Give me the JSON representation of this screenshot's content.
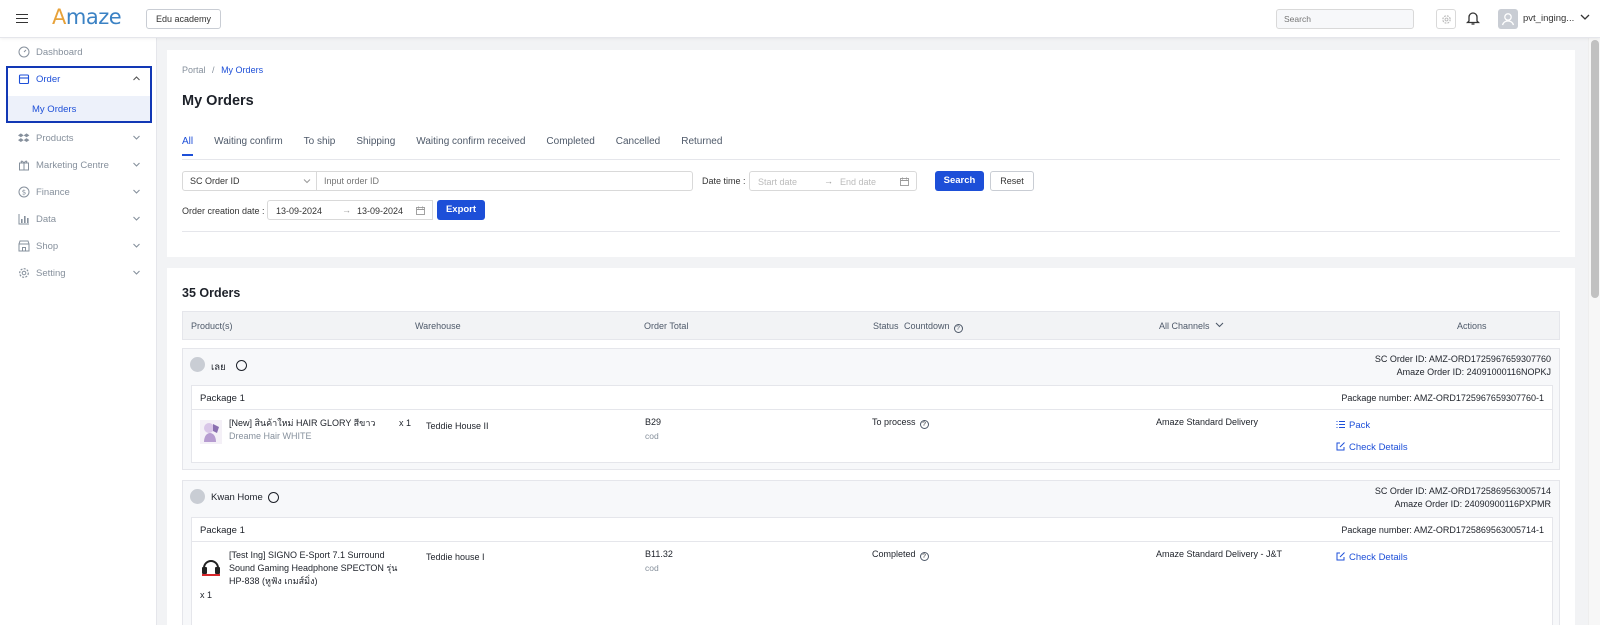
{
  "header": {
    "logo_prefix": "A",
    "logo_rest": "maze",
    "org_button": "Edu academy",
    "search_placeholder": "Search",
    "user_name": "pvt_inging..."
  },
  "sidebar": {
    "items": [
      {
        "label": "Dashboard",
        "icon": "dashboard-icon"
      },
      {
        "label": "Order",
        "icon": "order-icon"
      },
      {
        "label": "Products",
        "icon": "products-icon"
      },
      {
        "label": "Marketing Centre",
        "icon": "marketing-icon"
      },
      {
        "label": "Finance",
        "icon": "finance-icon"
      },
      {
        "label": "Data",
        "icon": "data-icon"
      },
      {
        "label": "Shop",
        "icon": "shop-icon"
      },
      {
        "label": "Setting",
        "icon": "setting-icon"
      }
    ],
    "sub_item": "My Orders"
  },
  "breadcrumb": {
    "root": "Portal",
    "sep": "/",
    "current": "My Orders"
  },
  "page_title": "My Orders",
  "tabs": [
    "All",
    "Waiting confirm",
    "To ship",
    "Shipping",
    "Waiting confirm received",
    "Completed",
    "Cancelled",
    "Returned"
  ],
  "filters": {
    "id_type": "SC Order ID",
    "order_id_placeholder": "Input order ID",
    "date_time_label": "Date time :",
    "start_placeholder": "Start date",
    "end_placeholder": "End date",
    "arrow": "→",
    "search_btn": "Search",
    "reset_btn": "Reset",
    "creation_label": "Order creation date :",
    "creation_start": "13-09-2024",
    "creation_end": "13-09-2024",
    "export_btn": "Export"
  },
  "orders_count": "35 Orders",
  "table_headers": {
    "product": "Product(s)",
    "warehouse": "Warehouse",
    "order_total": "Order Total",
    "status": "Status",
    "countdown": "Countdown",
    "channels": "All Channels",
    "actions": "Actions"
  },
  "orders": [
    {
      "shop": "เลย",
      "sc_order_id": "SC Order ID: AMZ-ORD1725967659307760",
      "amaze_order_id": "Amaze Order ID: 24091000116NOPKJ",
      "package_title": "Package 1",
      "package_number": "Package number: AMZ-ORD1725967659307760-1",
      "product_name": "[New] สินค้าใหม่ HAIR GLORY สีขาว",
      "product_variant": "Dreame Hair WHITE",
      "qty": "x 1",
      "warehouse": "Teddie House II",
      "total": "B29",
      "payment": "cod",
      "status": "To process",
      "channel": "Amaze Standard Delivery",
      "actions": [
        "Pack",
        "Check Details"
      ]
    },
    {
      "shop": "Kwan Home",
      "sc_order_id": "SC Order ID: AMZ-ORD1725869563005714",
      "amaze_order_id": "Amaze Order ID: 24090900116PXPMR",
      "package_title": "Package 1",
      "package_number": "Package number: AMZ-ORD1725869563005714-1",
      "product_name": "[Test Ing] SIGNO E-Sport 7.1 Surround Sound Gaming Headphone SPECTON รุ่น HP-838 (หูฟัง เกมส์มิ่ง)",
      "qty": "x 1",
      "warehouse": "Teddie house I",
      "total": "B11.32",
      "payment": "cod",
      "status": "Completed",
      "channel": "Amaze Standard Delivery - J&T",
      "actions": [
        "Check Details"
      ]
    }
  ],
  "colors": {
    "primary": "#1d4fd8",
    "focus_outline": "#1238b5",
    "logo_blue": "#3b82c4",
    "logo_orange": "#e7a23a"
  }
}
